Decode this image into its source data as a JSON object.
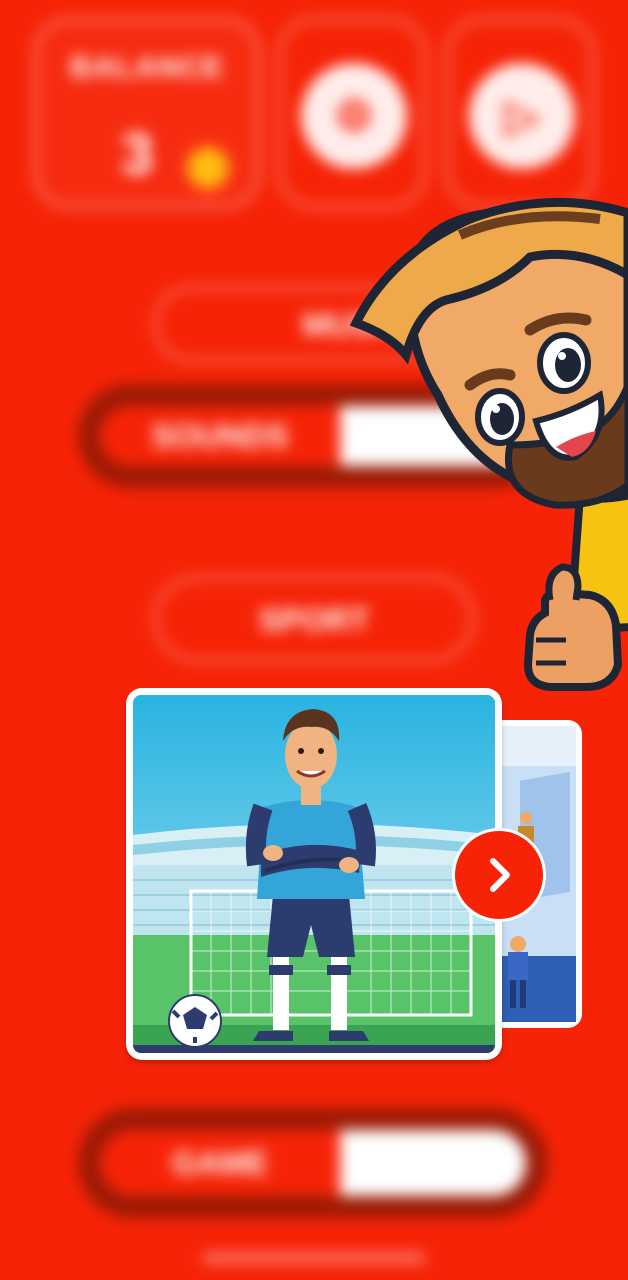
{
  "colors": {
    "background": "#f62307",
    "toggle_track": "#9b1a05",
    "accent_white": "#ffffff",
    "coin": "#ffbd0d"
  },
  "balance": {
    "title": "BALANCE",
    "value": "3",
    "coin_icon": "coin-icon"
  },
  "top_buttons": [
    {
      "name": "settings-button",
      "icon": "gear-icon",
      "glyph": "⚙"
    },
    {
      "name": "play-button",
      "icon": "play-icon",
      "glyph": "▷"
    }
  ],
  "menu": {
    "music_label": "MUSIC",
    "sound_label": "SOUNDS",
    "sport_label": "SPORT",
    "game_label": "GAME"
  },
  "carousel": {
    "next_icon": "chevron-right-icon"
  }
}
